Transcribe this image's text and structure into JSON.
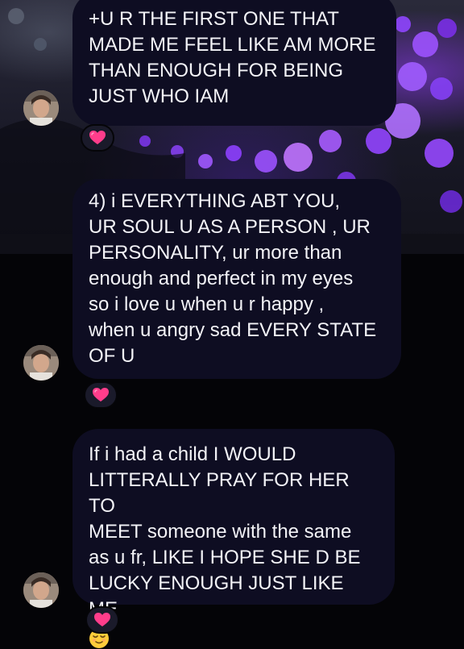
{
  "messages": [
    {
      "text": "+U R THE FIRST ONE THAT\nMADE ME FEEL LIKE AM MORE\nTHAN ENOUGH FOR BEING\nJUST WHO IAM",
      "reaction": "heart-icon"
    },
    {
      "text": "4) i EVERYTHING ABT YOU,\nUR SOUL U AS A PERSON , UR\nPERSONALITY, ur more than\nenough and perfect in my eyes\nso i love u when u r happy ,\nwhen u angry sad EVERY STATE\nOF U",
      "reaction": "heart-icon"
    },
    {
      "text": "If i had a child I WOULD\nLITTERALLY PRAY FOR HER TO\nMEET someone with the same\nas u fr, LIKE I HOPE SHE D BE\nLUCKY ENOUGH JUST LIKE ME",
      "emoji": "relieved-face-emoji",
      "reaction": "heart-icon"
    }
  ],
  "colors": {
    "bubble": "#0e0d22",
    "text": "#f3f3f7",
    "background": "#040407",
    "heart": "#ff3d8b",
    "wallpaper_flowers": "#8a3dff"
  }
}
